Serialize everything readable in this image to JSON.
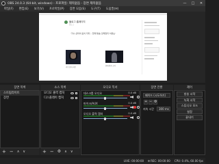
{
  "window": {
    "title": "OBS 24.0.3 (64-bit, windows) - 프로파일: 제목없음 - 장면 제목없음",
    "controls": [
      "—",
      "□",
      "✕"
    ]
  },
  "menu": [
    "파일(F)",
    "편집(E)",
    "보기(V)",
    "프로파일(P)",
    "장면 모음(S)",
    "도구(T)",
    "도움말(H)"
  ],
  "preview": {
    "site_name": "블로그 홈페이지",
    "site_sub": "블로그",
    "headline": "'가수 선미의 공식 지지 – 현재 방송 강제정지 이유는'",
    "caption_left": "가수 선미 사진",
    "caption_right": "현재 방송 소식"
  },
  "scenes": {
    "header": "장면 목록",
    "items": [
      "스트림라이트",
      "장면"
    ]
  },
  "sources": {
    "header": "소스 목록",
    "items": [
      "오디오 출력 캡처",
      "디스플레이 캡처"
    ]
  },
  "mixer": {
    "header": "오디오 믹서",
    "channels": [
      {
        "name": "데스크톱 오디오",
        "db": "0.0 dB",
        "muted": false
      },
      {
        "name": "마이크/AUX",
        "db": "0.0 dB",
        "muted": true
      },
      {
        "name": "오디오 출력 캡처",
        "db": "0.0 dB",
        "muted": false
      }
    ]
  },
  "transitions": {
    "header": "장면 전환",
    "type": "페이드 (시도하기)",
    "duration_label": "지속 시간",
    "duration_value": "300 ms"
  },
  "controls": {
    "header": "제어",
    "buttons": [
      "방송 시작",
      "녹화 시작",
      "스튜디오 모드",
      "설정",
      "끝내기"
    ]
  },
  "status": {
    "live": "LIVE: 00:00:00",
    "rec": "REC: 00:00:00",
    "cpu": "CPU: 0.4%, 60.00 fps"
  },
  "colors": {
    "background": "#1e1e1e",
    "meter_green": "#1f5f1f",
    "meter_yellow": "#6b6c24",
    "meter_red": "#6e2222",
    "mute_red": "#dd3333"
  }
}
